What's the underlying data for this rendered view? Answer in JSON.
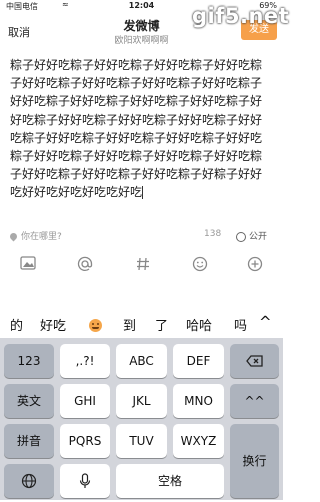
{
  "statusbar": {
    "carrier": "中国电信",
    "wifi": "≈",
    "time": "12:04",
    "battery": "69%"
  },
  "navbar": {
    "cancel_label": "取消",
    "title": "发微博",
    "subtitle": "欧阳欢啊啊啊",
    "send_label": "发送"
  },
  "watermark": "gif5.net",
  "compose": {
    "text": "粽子好好吃粽子好好吃粽子好好吃粽子好好吃粽子好好吃粽子好好吃粽子好好吃粽子好好吃粽子好好吃粽子好好吃粽子好好吃粽子好好吃粽子好好吃粽子好好吃粽子好好吃粽子好好吃粽子好好吃粽子好好吃粽子好好吃粽子好好吃粽子好好吃粽子好好吃粽子好好吃粽子好好吃粽子好好吃粽子好好吃粽子好好吃粽子好好吃粽子好粽子好好吃好好吃好吃好吃吃好吃"
  },
  "meta": {
    "location_placeholder": "你在哪里?",
    "char_count": "138",
    "visibility": "公开"
  },
  "toolbar": {
    "icons": [
      "image-icon",
      "mention-icon",
      "hashtag-icon",
      "emoji-icon",
      "add-icon"
    ]
  },
  "candidates": {
    "items": [
      "的",
      "好吃",
      "到",
      "了",
      "哈哈",
      "吗"
    ],
    "expand": "^"
  },
  "keyboard": {
    "row1": [
      "123",
      ",.?!",
      "ABC",
      "DEF",
      "⌫"
    ],
    "row2": [
      "英文",
      "GHI",
      "JKL",
      "MNO",
      "^^"
    ],
    "row3": [
      "拼音",
      "PQRS",
      "TUV",
      "WXYZ",
      "换行"
    ],
    "row4": [
      "globe-icon",
      "mic-icon",
      "空格"
    ]
  }
}
